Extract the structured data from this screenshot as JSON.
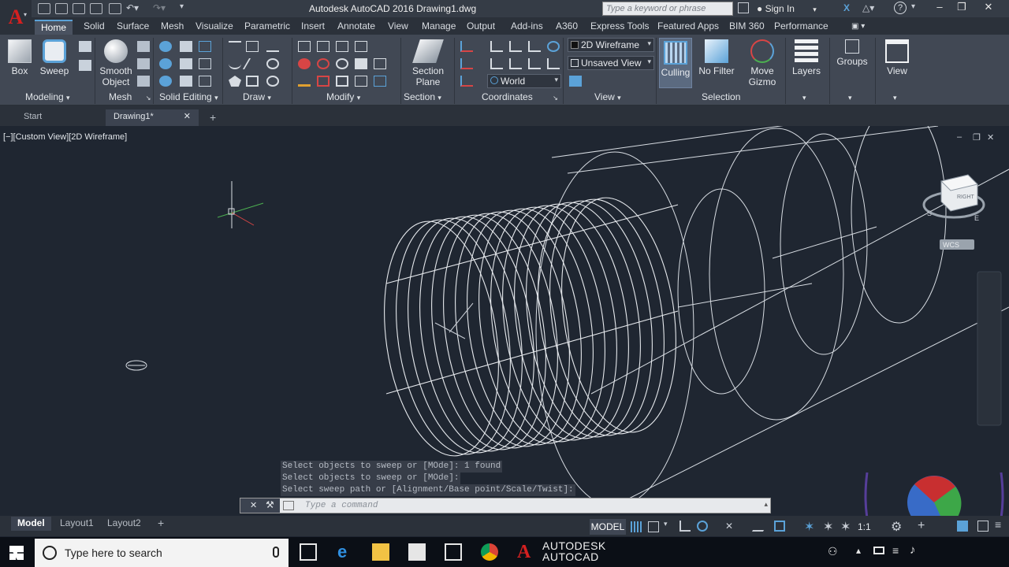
{
  "app": {
    "logo_letter": "A",
    "window_title": "Autodesk AutoCAD 2016    Drawing1.dwg",
    "search_placeholder": "Type a keyword or phrase",
    "signin_label": "Sign In",
    "help_label": "?"
  },
  "ribbon_tabs": [
    "Home",
    "Solid",
    "Surface",
    "Mesh",
    "Visualize",
    "Parametric",
    "Insert",
    "Annotate",
    "View",
    "Manage",
    "Output",
    "Add-ins",
    "A360",
    "Express Tools",
    "Featured Apps",
    "BIM 360",
    "Performance"
  ],
  "active_tab": "Home",
  "ribbon": {
    "box_label": "Box",
    "sweep_label": "Sweep",
    "smooth_object_label_1": "Smooth",
    "smooth_object_label_2": "Object",
    "section_plane_label_1": "Section",
    "section_plane_label_2": "Plane",
    "visual_style": "2D Wireframe",
    "saved_view": "Unsaved View",
    "ucs": "World",
    "culling_label": "Culling",
    "no_filter_label": "No Filter",
    "move_gizmo_label_1": "Move",
    "move_gizmo_label_2": "Gizmo",
    "layers_label": "Layers",
    "groups_label": "Groups",
    "view_label": "View",
    "panels": {
      "modeling": "Modeling",
      "mesh": "Mesh",
      "solid_editing": "Solid Editing",
      "draw": "Draw",
      "modify": "Modify",
      "section": "Section",
      "coordinates": "Coordinates",
      "view": "View",
      "selection": "Selection"
    }
  },
  "file_tabs": {
    "start": "Start",
    "drawing": "Drawing1*",
    "add": "+"
  },
  "viewport": {
    "label": "[−][Custom View][2D Wireframe]",
    "viewcube_face": "RIGHT",
    "wcs_label": "WCS",
    "compass_s": "S",
    "compass_e": "E"
  },
  "command": {
    "history": [
      "Select objects to sweep or [MOde]: 1 found",
      "Select objects to sweep or [MOde]:",
      "Select sweep path or [Alignment/Base point/Scale/Twist]:"
    ],
    "input_placeholder": "Type a command"
  },
  "layout_tabs": [
    "Model",
    "Layout1",
    "Layout2"
  ],
  "layout_add": "+",
  "status": {
    "model_button": "MODEL",
    "scale": "1:1"
  },
  "taskbar": {
    "search_placeholder": "Type here to search",
    "autocad_line1": "AUTODESK",
    "autocad_line2": "AUTOCAD"
  },
  "colors": {
    "accent": "#5ba2d8",
    "background": "#1f2631",
    "ribbon": "#414854",
    "logo_red": "#d42020"
  }
}
